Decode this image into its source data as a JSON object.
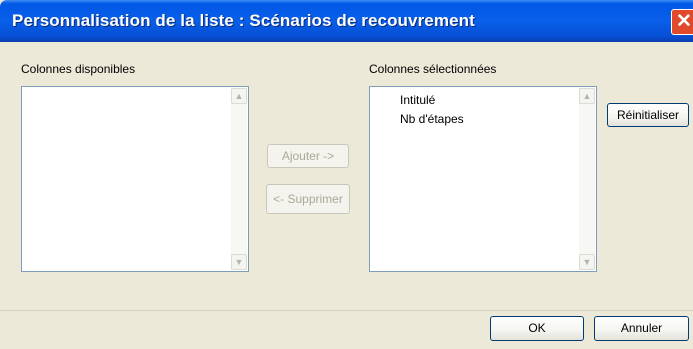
{
  "window": {
    "title": "Personnalisation de la liste : Scénarios de recouvrement",
    "close_glyph": "✕"
  },
  "available": {
    "label": "Colonnes disponibles",
    "items": []
  },
  "selected": {
    "label": "Colonnes sélectionnées",
    "items": [
      "Intitulé",
      "Nb d'étapes"
    ]
  },
  "buttons": {
    "add": "Ajouter ->",
    "remove": "<- Supprimer",
    "reset": "Réinitialiser",
    "ok": "OK",
    "cancel": "Annuler"
  },
  "scroll_glyphs": {
    "up": "▲",
    "down": "▼"
  },
  "colors": {
    "titlebar": "#0058e6",
    "client_bg": "#ece9d8",
    "list_border": "#7f9db9",
    "close_btn": "#e04a2a"
  }
}
